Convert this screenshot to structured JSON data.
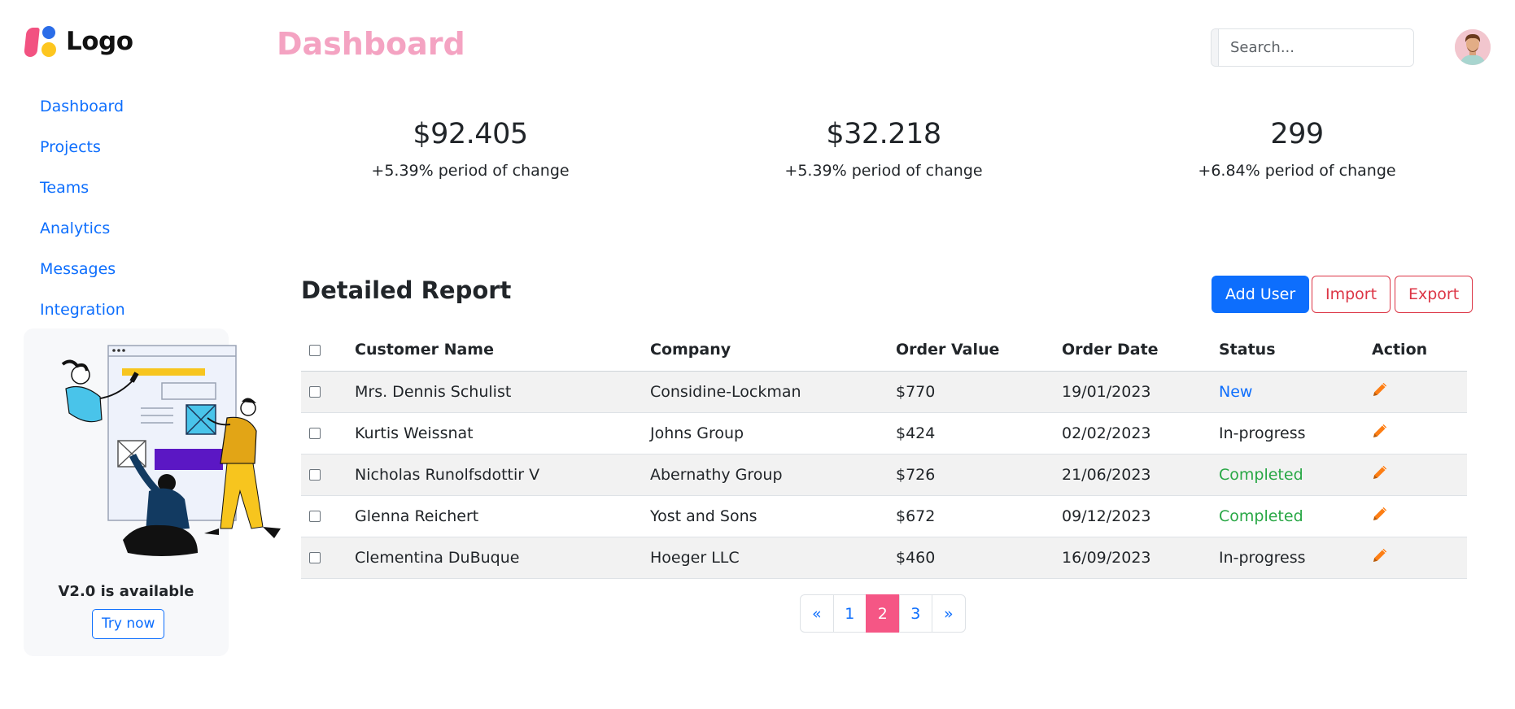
{
  "brand": {
    "logo_text": "Logo"
  },
  "sidebar": {
    "items": [
      {
        "label": "Dashboard"
      },
      {
        "label": "Projects"
      },
      {
        "label": "Teams"
      },
      {
        "label": "Analytics"
      },
      {
        "label": "Messages"
      },
      {
        "label": "Integration"
      }
    ],
    "promo": {
      "title": "V2.0 is available",
      "button_label": "Try now"
    }
  },
  "header": {
    "title": "Dashboard",
    "search": {
      "placeholder": "Search...",
      "value": ""
    }
  },
  "stats": [
    {
      "value": "$92.405",
      "change": "+5.39% period of change"
    },
    {
      "value": "$32.218",
      "change": "+5.39% period of change"
    },
    {
      "value": "299",
      "change": "+6.84% period of change"
    }
  ],
  "report": {
    "title": "Detailed Report",
    "buttons": {
      "add_user": "Add User",
      "import": "Import",
      "export": "Export"
    },
    "columns": [
      "Customer Name",
      "Company",
      "Order Value",
      "Order Date",
      "Status",
      "Action"
    ],
    "rows": [
      {
        "name": "Mrs. Dennis Schulist",
        "company": "Considine-Lockman",
        "value": "$770",
        "date": "19/01/2023",
        "status": "New"
      },
      {
        "name": "Kurtis Weissnat",
        "company": "Johns Group",
        "value": "$424",
        "date": "02/02/2023",
        "status": "In-progress"
      },
      {
        "name": "Nicholas Runolfsdottir V",
        "company": "Abernathy Group",
        "value": "$726",
        "date": "21/06/2023",
        "status": "Completed"
      },
      {
        "name": "Glenna Reichert",
        "company": "Yost and Sons",
        "value": "$672",
        "date": "09/12/2023",
        "status": "Completed"
      },
      {
        "name": "Clementina DuBuque",
        "company": "Hoeger LLC",
        "value": "$460",
        "date": "16/09/2023",
        "status": "In-progress"
      }
    ]
  },
  "pagination": {
    "prev": "«",
    "pages": [
      "1",
      "2",
      "3"
    ],
    "next": "»",
    "active": "2"
  },
  "colors": {
    "accent": "#0d6efd",
    "title_pink": "#f4a3c2",
    "active_page": "#f55685",
    "danger": "#dc3545",
    "success": "#28a745"
  }
}
